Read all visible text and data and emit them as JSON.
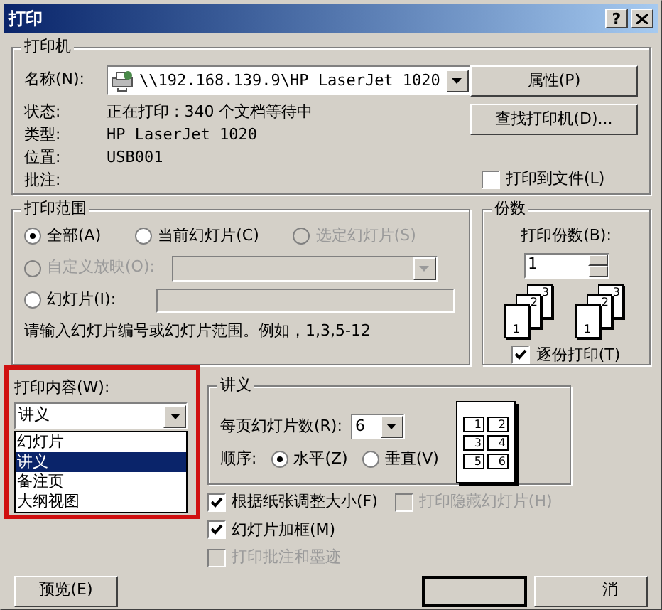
{
  "window": {
    "title": "打印",
    "help": "?"
  },
  "printer": {
    "title": "打印机",
    "name_label": "名称(N):",
    "name_value": "\\\\192.168.139.9\\HP LaserJet 1020",
    "status_label": "状态:",
    "status_value": "正在打印 : 340 个文档等待中",
    "type_label": "类型:",
    "type_value": "HP LaserJet 1020",
    "location_label": "位置:",
    "location_value": "USB001",
    "comment_label": "批注:",
    "properties_button": "属性(P)",
    "find_button": "查找打印机(D)...",
    "print_to_file": {
      "label": "打印到文件(L)",
      "checked": false
    }
  },
  "range": {
    "title": "打印范围",
    "options": [
      {
        "label": "全部(A)",
        "selected": true,
        "disabled": false
      },
      {
        "label": "当前幻灯片(C)",
        "selected": false,
        "disabled": false
      },
      {
        "label": "选定幻灯片(S)",
        "selected": false,
        "disabled": true
      },
      {
        "label": "自定义放映(O):",
        "selected": false,
        "disabled": true
      },
      {
        "label": "幻灯片(I):",
        "selected": false,
        "disabled": false
      }
    ],
    "hint": "请输入幻灯片编号或幻灯片范围。例如，1,3,5-12"
  },
  "copies": {
    "title": "份数",
    "label": "打印份数(B):",
    "value": "1",
    "stacks": [
      [
        "1",
        "2",
        "3"
      ],
      [
        "1",
        "2",
        "3"
      ]
    ],
    "collate": {
      "label": "逐份打印(T)",
      "checked": true
    }
  },
  "print_what": {
    "label": "打印内容(W):",
    "value": "讲义",
    "items": [
      {
        "label": "幻灯片",
        "selected": false
      },
      {
        "label": "讲义",
        "selected": true
      },
      {
        "label": "备注页",
        "selected": false
      },
      {
        "label": "大纲视图",
        "selected": false
      }
    ]
  },
  "handouts": {
    "title": "讲义",
    "per_page_label": "每页幻灯片数(R):",
    "per_page_value": "6",
    "order_label": "顺序:",
    "order": [
      {
        "label": "水平(Z)",
        "selected": true
      },
      {
        "label": "垂直(V)",
        "selected": false
      }
    ],
    "slots": [
      "1",
      "2",
      "3",
      "4",
      "5",
      "6"
    ]
  },
  "options": [
    {
      "label": "根据纸张调整大小(F)",
      "checked": true,
      "disabled": false
    },
    {
      "label": "打印隐藏幻灯片(H)",
      "checked": false,
      "disabled": true
    },
    {
      "label": "幻灯片加框(M)",
      "checked": true,
      "disabled": false
    },
    {
      "label": "打印批注和墨迹",
      "checked": false,
      "disabled": true
    }
  ],
  "buttons": {
    "preview": "预览(E)",
    "cancel": "消"
  }
}
